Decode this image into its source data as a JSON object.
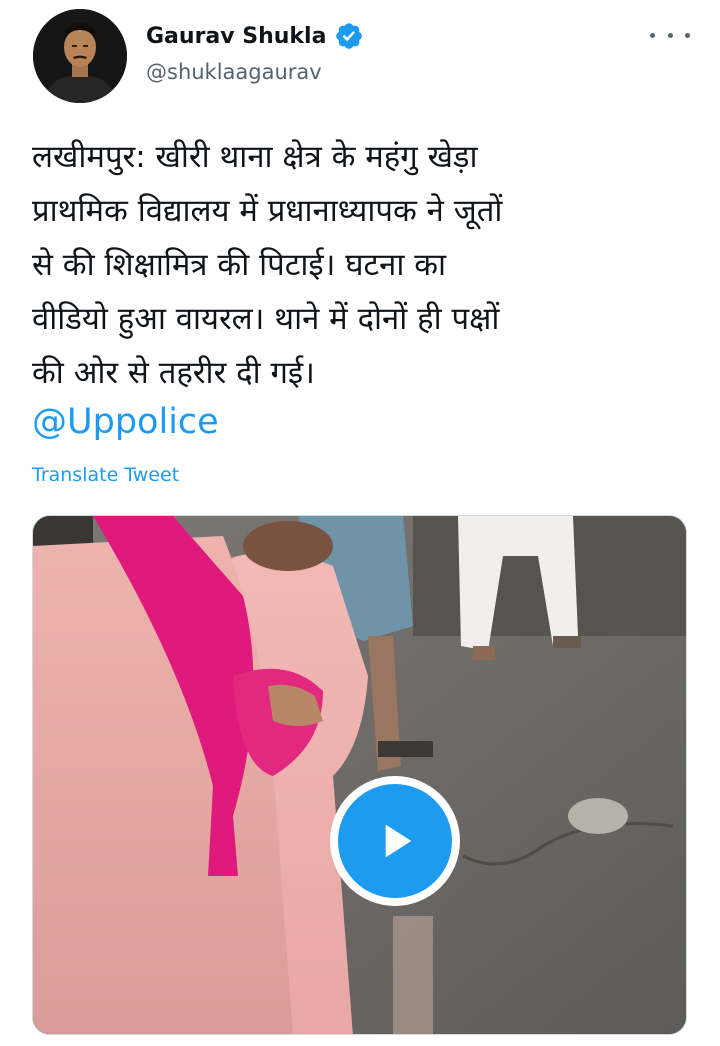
{
  "author": {
    "name": "Gaurav Shukla",
    "handle": "@shuklaagaurav",
    "verified_icon": "verified-badge-icon"
  },
  "tweet": {
    "text": "लखीमपुर: खीरी थाना क्षेत्र के महंगु खेड़ा\nप्राथमिक विद्यालय में प्रधानाध्यापक ने जूतों\nसे की शिक्षामित्र की पिटाई। घटना का\nवीडियो हुआ वायरल। थाने में दोनों ही पक्षों\nकी ओर से तहरीर दी गई।",
    "mention": "@Uppolice",
    "translate_label": "Translate Tweet"
  },
  "media": {
    "type": "video",
    "play_icon": "play-icon"
  },
  "colors": {
    "accent": "#1d9bf0",
    "text": "#0f1419",
    "secondary": "#536471"
  }
}
